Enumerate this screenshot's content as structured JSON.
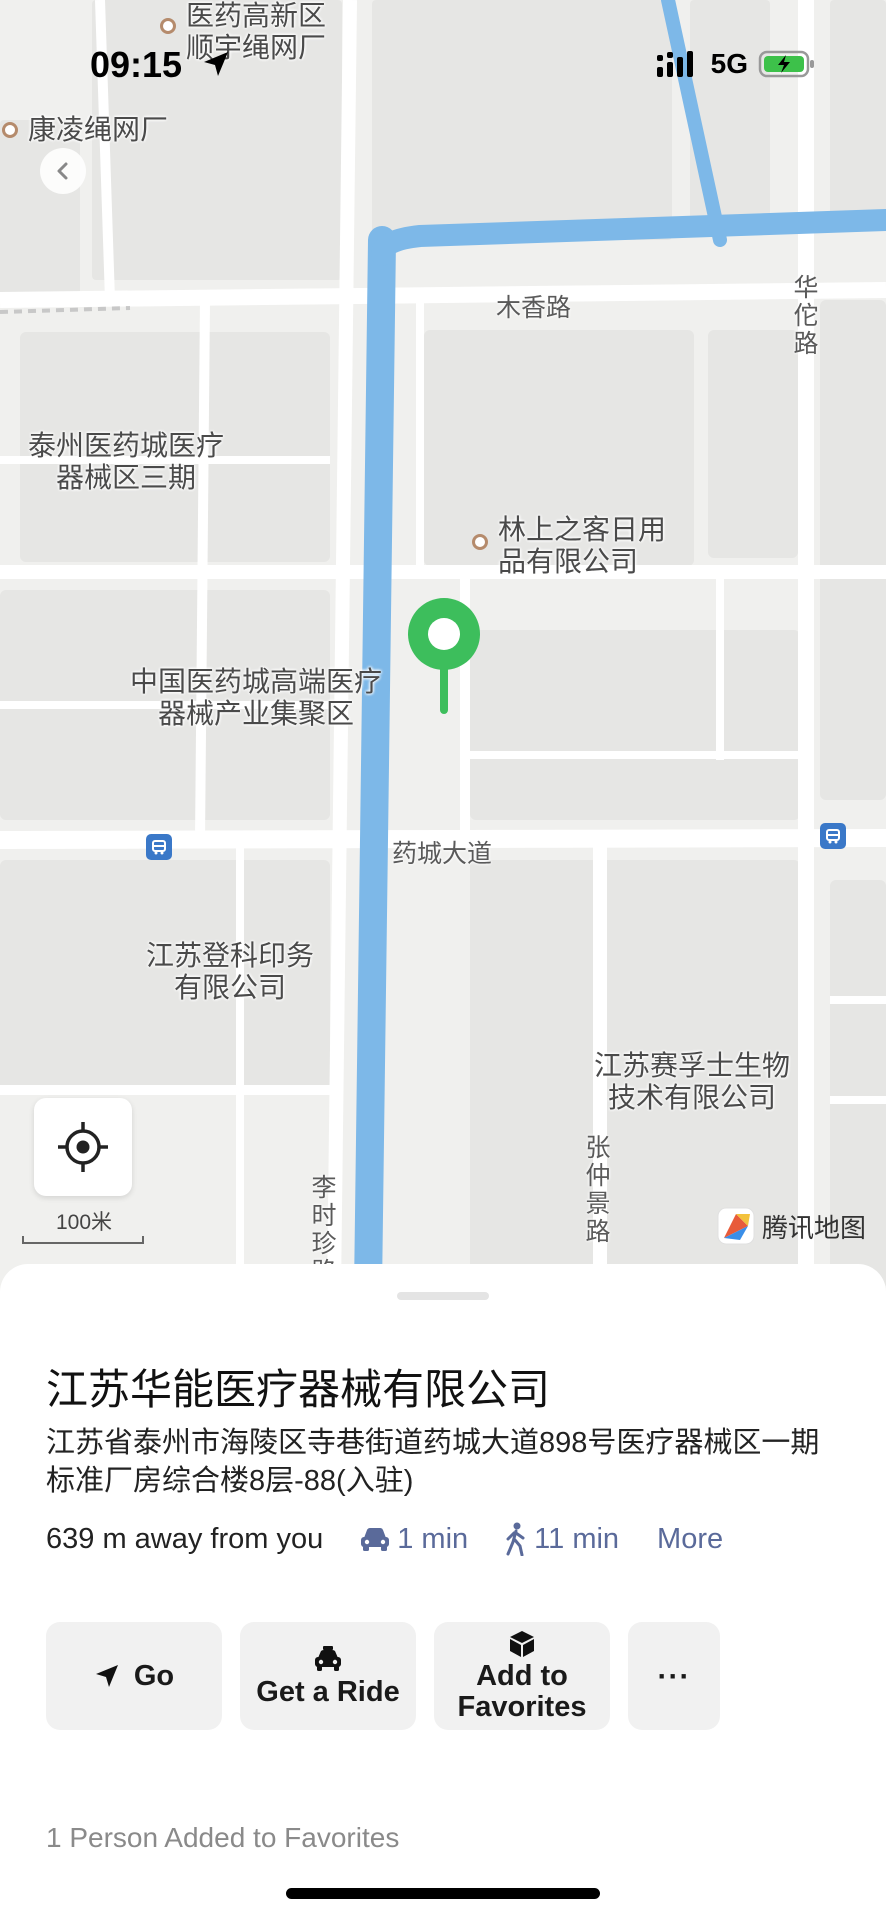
{
  "status_bar": {
    "time": "09:15",
    "network": "5G"
  },
  "map": {
    "pois": [
      {
        "id": "yiyao-gaoxin",
        "label": "医药高新区\n顺宇绳网厂"
      },
      {
        "id": "kangling",
        "label": "康凌绳网厂"
      },
      {
        "id": "linshang",
        "label": "林上之客日用\n品有限公司"
      }
    ],
    "areas": [
      {
        "id": "taizhou-yiyao",
        "label": "泰州医药城医疗\n器械区三期"
      },
      {
        "id": "zhongguo-yiyao",
        "label": "中国医药城高端医疗\n器械产业集聚区"
      },
      {
        "id": "dengke",
        "label": "江苏登科印务\n有限公司"
      },
      {
        "id": "saifushi",
        "label": "江苏赛孚士生物\n技术有限公司"
      }
    ],
    "roads": {
      "muxiang": "木香路",
      "huatuo": "华佗路",
      "yaocheng": "药城大道",
      "zhangzhongjing": "张仲景路",
      "lishizhen": "李时珍路"
    },
    "scale_label": "100米",
    "brand": "腾讯地图"
  },
  "place": {
    "name": "江苏华能医疗器械有限公司",
    "address": "江苏省泰州市海陵区寺巷街道药城大道898号医疗器械区一期标准厂房综合楼8层-88(入驻)",
    "distance": "639 m away from you",
    "drive_time": "1 min",
    "walk_time": "11 min",
    "more_label": "More"
  },
  "actions": {
    "go": "Go",
    "ride": "Get a Ride",
    "fav": "Add to Favorites",
    "more": "···"
  },
  "favorites_count_text": "1 Person Added to Favorites",
  "colors": {
    "accent": "#5a6a9a",
    "pin": "#3dbe5c",
    "water": "#7db8e8"
  }
}
